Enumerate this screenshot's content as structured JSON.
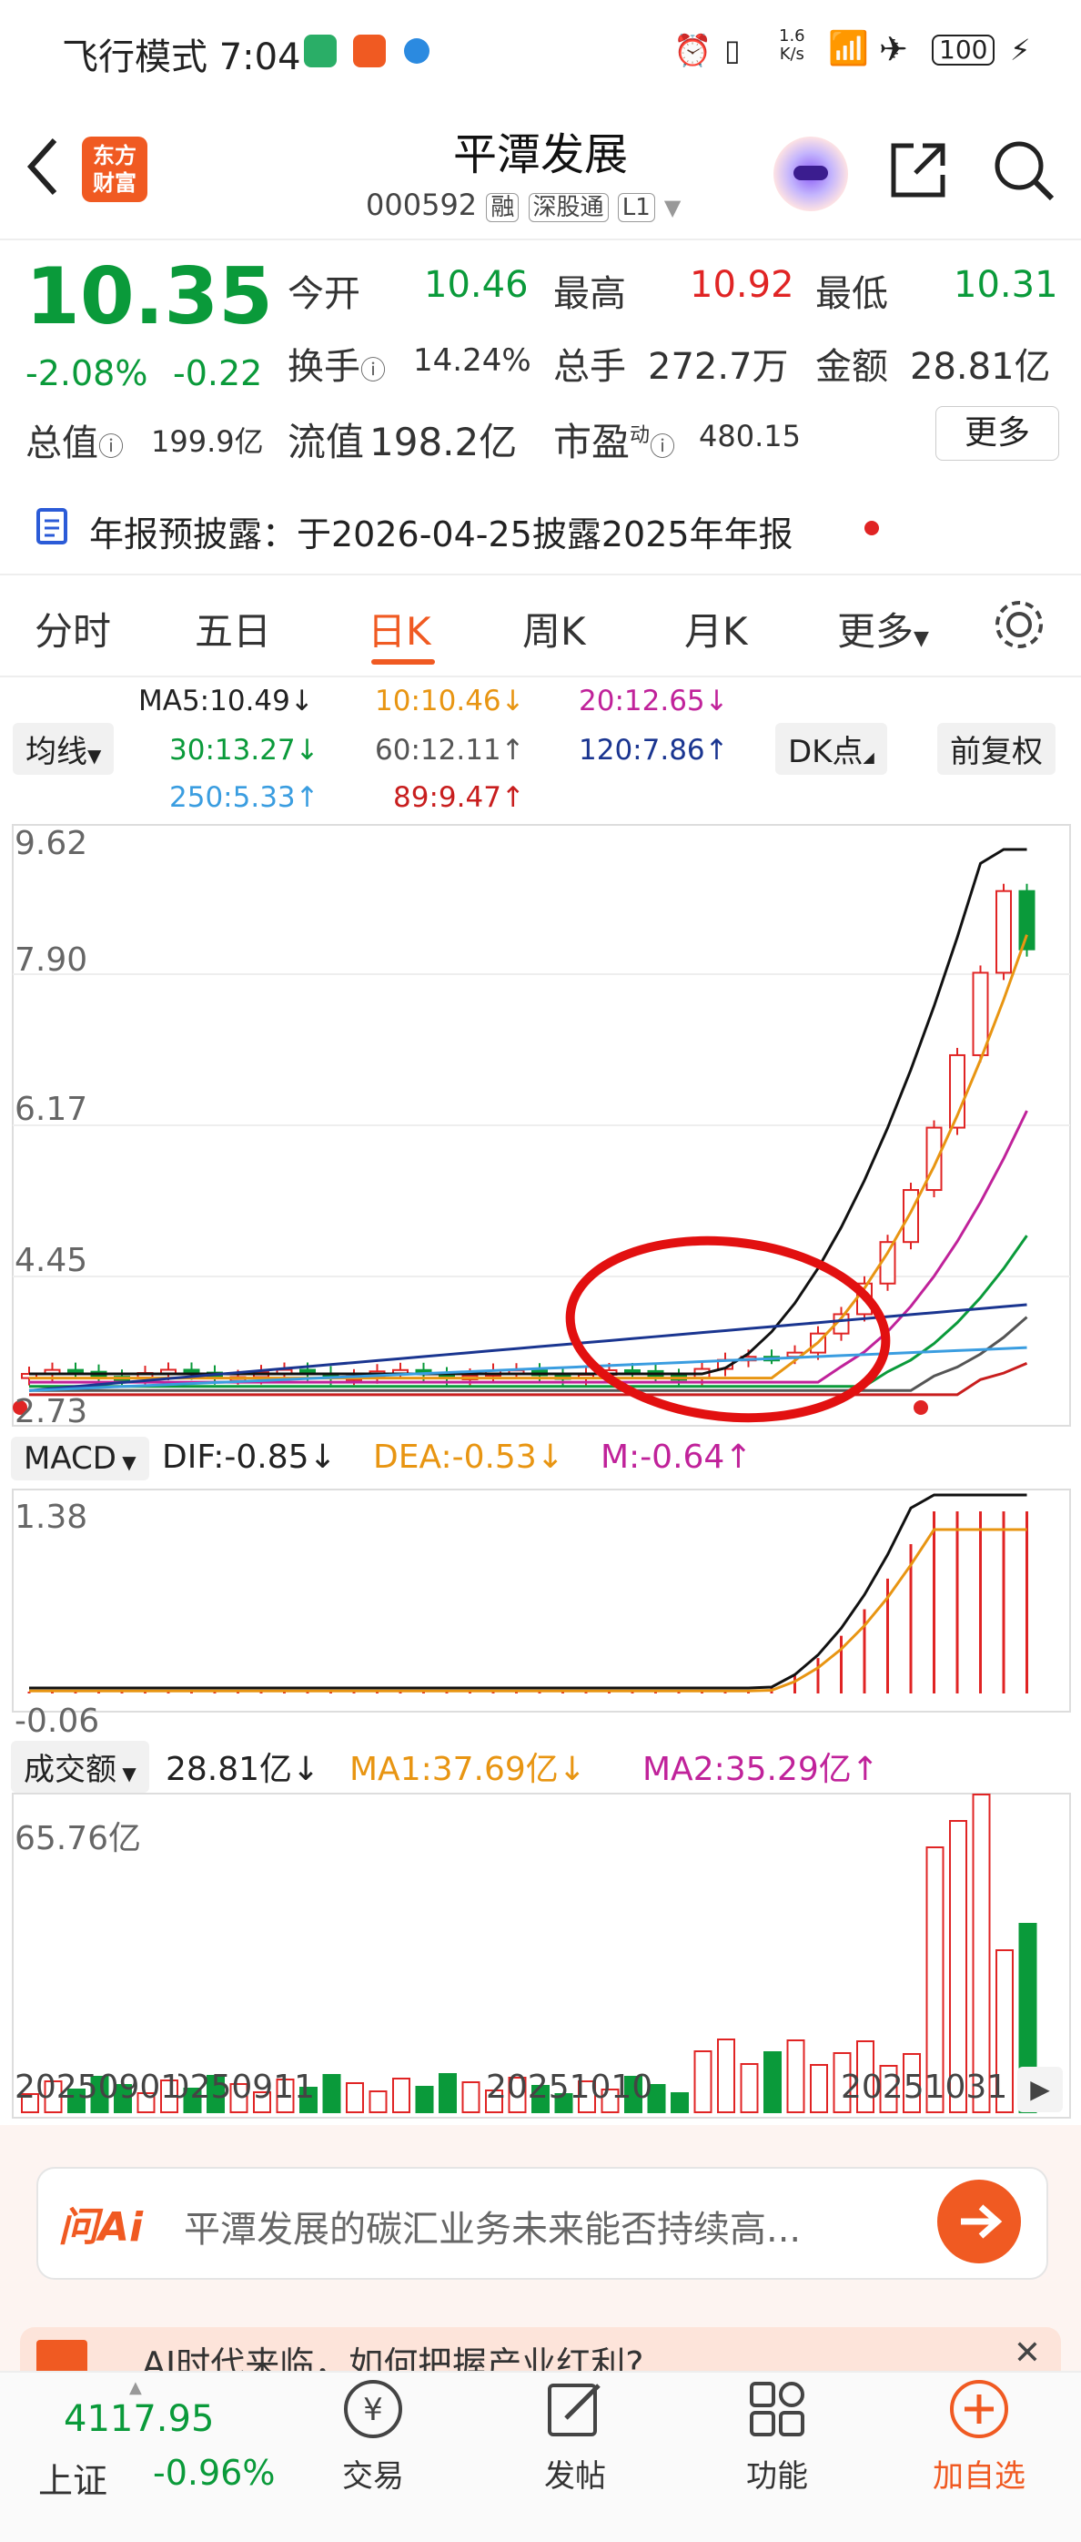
{
  "status_bar": {
    "mode": "飞行模式",
    "time": "7:04",
    "speed_top": "1.6",
    "speed_bottom": "K/s",
    "battery": "100"
  },
  "header": {
    "back_icon": "chevron-left-icon",
    "logo_line1": "东方",
    "logo_line2": "财富",
    "title": "平潭发展",
    "code": "000592",
    "tag_rong": "融",
    "tag_sgt": "深股通",
    "tag_level": "L1"
  },
  "quote": {
    "price": "10.35",
    "change_pct": "-2.08%",
    "change_abs": "-0.22",
    "open_label": "今开",
    "open": "10.46",
    "high_label": "最高",
    "high": "10.92",
    "low_label": "最低",
    "low": "10.31",
    "turnover_label": "换手",
    "turnover": "14.24%",
    "volume_label": "总手",
    "volume": "272.7万",
    "amount_label": "金额",
    "amount": "28.81亿",
    "mcap_label": "总值",
    "mcap": "199.9亿",
    "float_label": "流值",
    "float": "198.2亿",
    "pe_label": "市盈",
    "pe_sup": "动",
    "pe": "480.15",
    "more_button": "更多"
  },
  "notice": {
    "text": "年报预披露：于2026-04-25披露2025年年报"
  },
  "tabs": [
    "分时",
    "五日",
    "日K",
    "周K",
    "月K",
    "更多"
  ],
  "active_tab": 2,
  "ma_panel": {
    "selector": "均线",
    "ma5": "MA5:10.49↓",
    "ma10": "10:10.46↓",
    "ma20": "20:12.65↓",
    "ma30": "30:13.27↓",
    "ma60": "60:12.11↑",
    "ma120": "120:7.86↑",
    "ma250": "250:5.33↑",
    "ma89": "89:9.47↑",
    "dk_button": "DK点",
    "adjust_button": "前复权"
  },
  "kline_axis": [
    "9.62",
    "7.90",
    "6.17",
    "4.45",
    "2.73"
  ],
  "macd": {
    "selector": "MACD",
    "dif": "DIF:-0.85↓",
    "dea": "DEA:-0.53↓",
    "m": "M:-0.64↑",
    "axis_top": "1.38",
    "axis_bottom": "-0.06"
  },
  "volume_panel": {
    "selector": "成交额",
    "value": "28.81亿↓",
    "ma1": "MA1:37.69亿↓",
    "ma2": "MA2:35.29亿↑",
    "axis_top": "65.76亿"
  },
  "date_axis": [
    "20250901",
    "20250911",
    "20251010",
    "20251031"
  ],
  "ai_bar": {
    "label": "问Ai",
    "text": "平潭发展的碳汇业务未来能否持续高..."
  },
  "banner_text": "AI时代来临，如何把握产业红利?",
  "bottom_nav": {
    "index_value": "4117.95",
    "index_name": "上证",
    "index_change": "-0.96%",
    "items": [
      "交易",
      "发帖",
      "功能",
      "加自选"
    ]
  },
  "colors": {
    "up": "#e02424",
    "down": "#0a9a3a",
    "ma5": "#111111",
    "ma10": "#e89512",
    "ma20": "#c0229a",
    "ma30": "#0a9a3a",
    "ma60": "#555555",
    "ma120": "#1a3590",
    "ma250": "#3a9de0",
    "ma89": "#c81e1e",
    "accent": "#f05a22"
  }
}
